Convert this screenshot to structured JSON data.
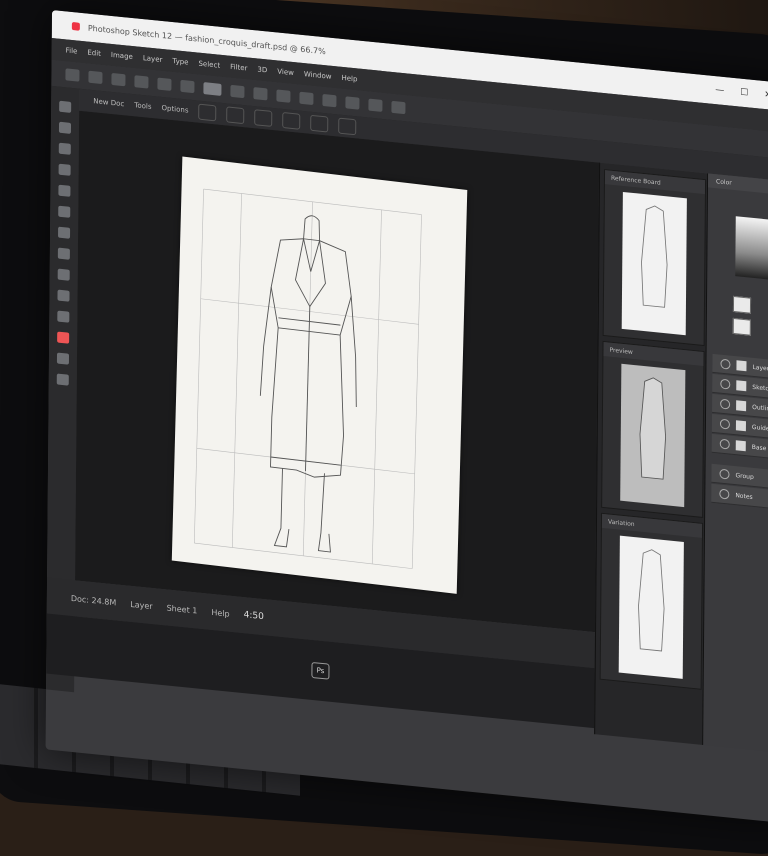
{
  "window": {
    "title": "Photoshop Sketch 12 — fashion_croquis_draft.psd @ 66.7%",
    "controls": [
      "—",
      "☐",
      "✕"
    ]
  },
  "menubar": {
    "items": [
      "File",
      "Edit",
      "Image",
      "Layer",
      "Type",
      "Select",
      "Filter",
      "3D",
      "View",
      "Window",
      "Help"
    ]
  },
  "docbar": {
    "items": [
      "New Doc",
      "Tools",
      "Options"
    ]
  },
  "statusbar": {
    "items": [
      "Doc: 24.8M",
      "Layer",
      "Sheet 1",
      "Help"
    ],
    "zoom": "4:50"
  },
  "taskbar": {
    "app_label": "Ps"
  },
  "panels": {
    "thumb1_head": "Reference Board",
    "thumb2_head": "Preview",
    "thumb3_head": "Variation",
    "right_head": "Color",
    "layers": [
      "Layer",
      "Sketch",
      "Outline",
      "Guides",
      "Base",
      "Group",
      "Notes"
    ]
  },
  "colors": {
    "accent": "#e34848",
    "ui_dark": "#2f2f31",
    "canvas": "#1b1b1c"
  }
}
